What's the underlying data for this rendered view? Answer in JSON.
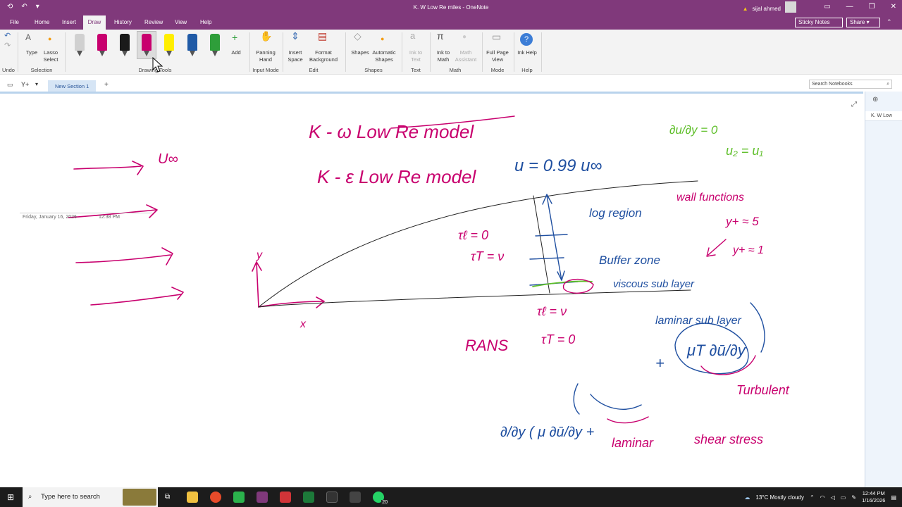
{
  "window": {
    "title": "K. W Low Re miles  -  OneNote",
    "user": "sijal ahmed",
    "sticky_notes": "Sticky Notes",
    "share": "Share"
  },
  "menu": {
    "tabs": [
      "File",
      "Home",
      "Insert",
      "Draw",
      "History",
      "Review",
      "View",
      "Help"
    ],
    "active": "Draw"
  },
  "ribbon": {
    "undo_group": "Undo",
    "type_label": "Type",
    "lasso_label": "Lasso Select",
    "selection_group": "Selection",
    "add_label": "Add",
    "drawing_group": "Drawing Tools",
    "panning_label": "Panning Hand",
    "input_group": "Input Mode",
    "insert_space_label": "Insert Space",
    "format_bg_label": "Format Background",
    "edit_group": "Edit",
    "shapes_label": "Shapes",
    "auto_shapes_label": "Automatic Shapes",
    "shapes_group": "Shapes",
    "ink_text_label": "Ink to Text",
    "text_group": "Text",
    "ink_math_label": "Ink to Math",
    "math_assist_label": "Math Assistant",
    "math_group": "Math",
    "fullpage_label": "Full Page View",
    "mode_group": "Mode",
    "inkhelp_label": "Ink Help",
    "help_group": "Help",
    "pen_colors": [
      "#d0d0d0",
      "#c8006e",
      "#1a1a1a",
      "#c8006e",
      "#ffee00",
      "#1f5aa6",
      "#2e9e3a"
    ]
  },
  "section": {
    "notebook": "Y+",
    "tab": "New Section 1",
    "search_placeholder": "Search Notebooks",
    "page_tab": "K. W Low"
  },
  "page": {
    "date": "Friday, January 16, 2026",
    "time": "12:38 PM"
  },
  "taskbar": {
    "search_placeholder": "Type here to search",
    "weather": "13°C  Mostly cloudy",
    "time": "12:44 PM",
    "date": "1/16/2026",
    "whatsapp_badge": "20"
  },
  "colors": {
    "accent": "#80397b",
    "ink_magenta": "#c8006e",
    "ink_blue": "#1f4fa0",
    "ink_green": "#5fbf2a",
    "ink_black": "#222222"
  }
}
